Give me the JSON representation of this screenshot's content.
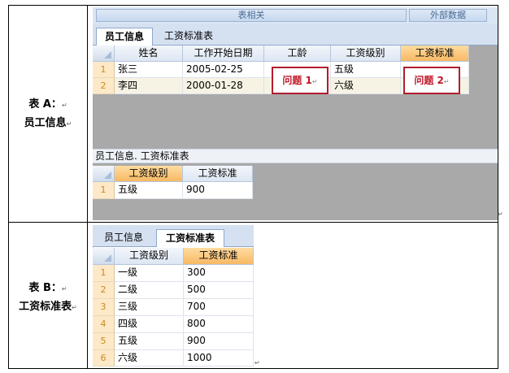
{
  "rows": [
    {
      "label_title": "表 A：",
      "label_sub": "员工信息"
    },
    {
      "label_title": "表 B：",
      "label_sub": "工资标准表"
    }
  ],
  "marks": {
    "paragraph": "↵"
  },
  "tableA": {
    "ribbon": {
      "group1": "表相关",
      "group2": "外部数据"
    },
    "tabs": [
      "员工信息",
      "工资标准表"
    ],
    "columns": [
      "姓名",
      "工作开始日期",
      "工龄",
      "工资级别",
      "工资标准"
    ],
    "data": [
      {
        "num": "1",
        "name": "张三",
        "date": "2005-02-25",
        "level": "五级"
      },
      {
        "num": "2",
        "name": "李四",
        "date": "2000-01-28",
        "level": "六级"
      }
    ],
    "issue1": "问题 1",
    "issue2": "问题 2",
    "subform_title": "员工信息. 工资标准表",
    "subform_columns": [
      "工资级别",
      "工资标准"
    ],
    "subform_data": [
      {
        "num": "1",
        "level": "五级",
        "salary": "900"
      }
    ]
  },
  "tableB": {
    "tabs": [
      "员工信息",
      "工资标准表"
    ],
    "columns": [
      "工资级别",
      "工资标准"
    ],
    "data": [
      {
        "num": "1",
        "level": "一级",
        "salary": "300"
      },
      {
        "num": "2",
        "level": "二级",
        "salary": "500"
      },
      {
        "num": "3",
        "level": "三级",
        "salary": "700"
      },
      {
        "num": "4",
        "level": "四级",
        "salary": "800"
      },
      {
        "num": "5",
        "level": "五级",
        "salary": "900"
      },
      {
        "num": "6",
        "level": "六级",
        "salary": "1000"
      }
    ]
  }
}
